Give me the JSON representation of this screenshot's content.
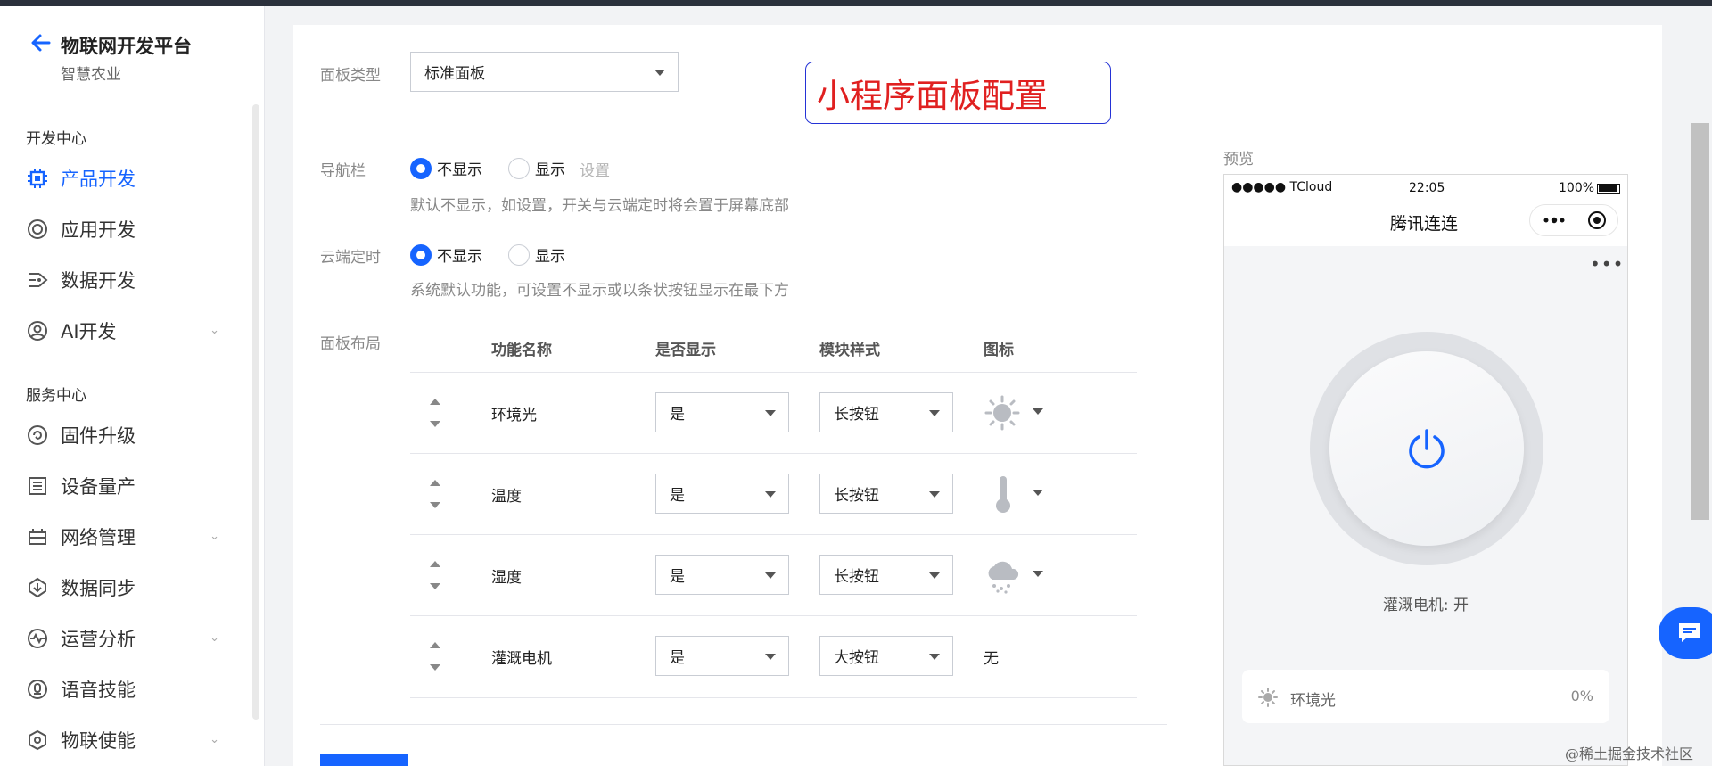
{
  "sidebar": {
    "title": "物联网开发平台",
    "subtitle": "智慧农业",
    "dev_center": "开发中心",
    "service_center": "服务中心",
    "items": [
      {
        "label": "产品开发",
        "icon": "chip-icon",
        "active": true
      },
      {
        "label": "应用开发",
        "icon": "app-icon"
      },
      {
        "label": "数据开发",
        "icon": "data-flow-icon"
      },
      {
        "label": "AI开发",
        "icon": "ai-icon",
        "expandable": true
      },
      {
        "label": "固件升级",
        "icon": "firmware-icon"
      },
      {
        "label": "设备量产",
        "icon": "device-list-icon"
      },
      {
        "label": "网络管理",
        "icon": "network-icon",
        "expandable": true
      },
      {
        "label": "数据同步",
        "icon": "sync-icon"
      },
      {
        "label": "运营分析",
        "icon": "analytics-icon",
        "expandable": true
      },
      {
        "label": "语音技能",
        "icon": "voice-icon"
      },
      {
        "label": "物联使能",
        "icon": "iot-enable-icon",
        "expandable": true
      }
    ]
  },
  "form": {
    "panel_type_label": "面板类型",
    "panel_type_value": "标准面板",
    "nav_label": "导航栏",
    "nav_opt_hide": "不显示",
    "nav_opt_show": "显示",
    "nav_setting": "设置",
    "nav_hint": "默认不显示，如设置，开关与云端定时将会置于屏幕底部",
    "timer_label": "云端定时",
    "timer_opt_hide": "不显示",
    "timer_opt_show": "显示",
    "timer_hint": "系统默认功能，可设置不显示或以条状按钮显示在最下方",
    "layout_label": "面板布局"
  },
  "callout": "小程序面板配置",
  "table": {
    "headers": [
      "功能名称",
      "是否显示",
      "模块样式",
      "图标"
    ],
    "rows": [
      {
        "name": "环境光",
        "show": "是",
        "style": "长按钮",
        "icon": "sun-icon"
      },
      {
        "name": "温度",
        "show": "是",
        "style": "长按钮",
        "icon": "thermometer-icon"
      },
      {
        "name": "湿度",
        "show": "是",
        "style": "长按钮",
        "icon": "rain-cloud-icon"
      },
      {
        "name": "灌溉电机",
        "show": "是",
        "style": "大按钮",
        "icon_text": "无"
      }
    ]
  },
  "preview": {
    "label": "预览",
    "carrier": "●●●●● TCloud",
    "time": "22:05",
    "battery": "100%",
    "app_title": "腾讯连连",
    "more": "•••",
    "status": "灌溉电机: 开",
    "row_name": "环境光",
    "row_value": "0%"
  },
  "watermark": "@稀土掘金技术社区",
  "colors": {
    "primary": "#1664ff",
    "callout_text": "#e02020",
    "callout_border": "#2432d6"
  }
}
